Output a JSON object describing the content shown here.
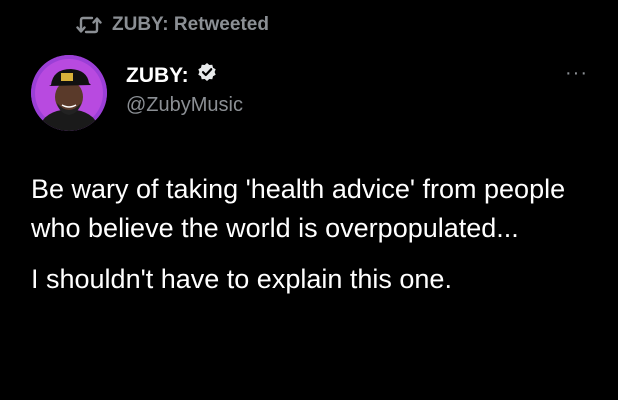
{
  "retweet": {
    "icon": "retweet-icon",
    "text": "ZUBY: Retweeted"
  },
  "author": {
    "name": "ZUBY:",
    "verified_icon": "verified-badge-icon",
    "handle": "@ZubyMusic",
    "avatar_ring_color": "#9b3fd6"
  },
  "more_menu": {
    "icon": "more-icon",
    "glyph": "···"
  },
  "tweet": {
    "paragraph1": "Be wary of taking 'health advice' from people who believe the world is overpopulated...",
    "paragraph2": "I shouldn't have to explain this one."
  }
}
